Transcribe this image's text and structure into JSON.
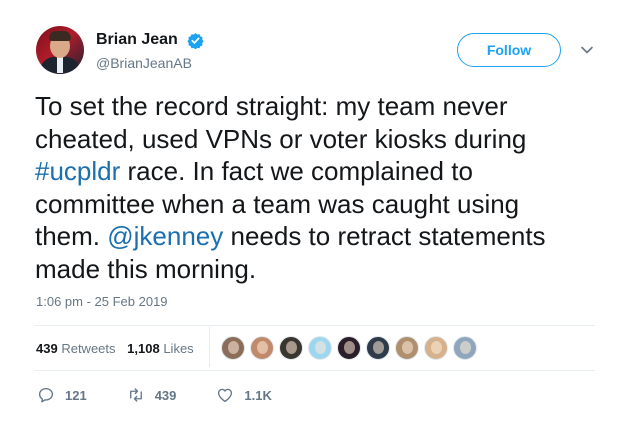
{
  "author": {
    "name": "Brian Jean",
    "handle": "@BrianJeanAB",
    "verified": true
  },
  "follow_label": "Follow",
  "tweet": {
    "line1": "To set the record straight: my team never",
    "line2": "cheated, used VPNs or voter kiosks during",
    "hashtag": "#ucpldr",
    "line3_rest": " race. In fact we complained to",
    "line4": "committee when a team was caught using",
    "line5_start": "them. ",
    "mention": "@jkenney",
    "line5_rest": " needs to retract statements",
    "line6": "made this morning."
  },
  "timestamp": "1:06 pm - 25 Feb 2019",
  "stats": {
    "retweets_count": "439",
    "retweets_label": "Retweets",
    "likes_count": "1,108",
    "likes_label": "Likes"
  },
  "likers": [
    {
      "name": "liker-1",
      "color": "#8a6d5a"
    },
    {
      "name": "liker-2",
      "color": "#c08a6b"
    },
    {
      "name": "liker-3",
      "color": "#3b3530"
    },
    {
      "name": "liker-4",
      "color": "#9fd6ef"
    },
    {
      "name": "liker-5",
      "color": "#2a1e28"
    },
    {
      "name": "liker-6",
      "color": "#2f3a4a"
    },
    {
      "name": "liker-7",
      "color": "#b08f6e"
    },
    {
      "name": "liker-8",
      "color": "#d5b18d"
    },
    {
      "name": "liker-9",
      "color": "#8fa6bd"
    }
  ],
  "actions": {
    "replies": "121",
    "retweets": "439",
    "likes": "1.1K"
  },
  "colors": {
    "accent": "#1da1f2",
    "link": "#1b6faf",
    "muted": "#657786",
    "text": "#14171a"
  }
}
